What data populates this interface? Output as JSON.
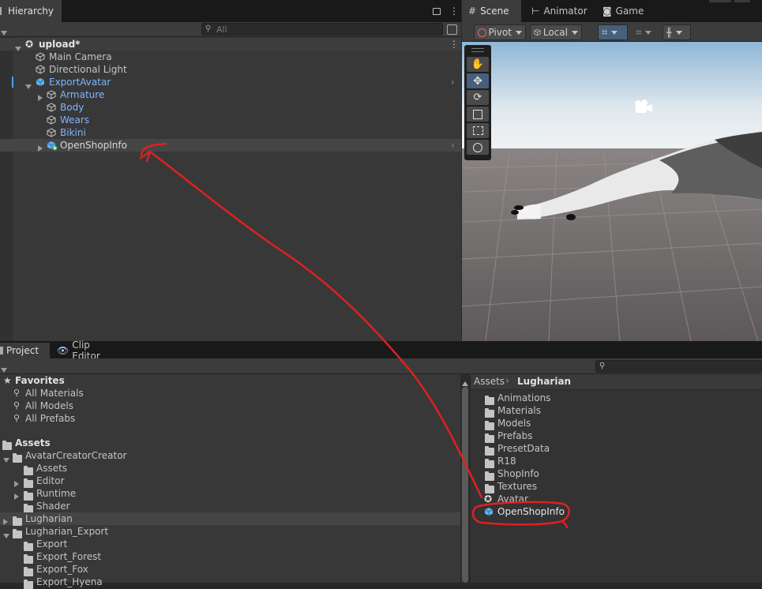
{
  "hierarchy": {
    "tab_label": "Hierarchy",
    "search_placeholder": "All",
    "scene_name": "upload*",
    "items": [
      {
        "label": "Main Camera"
      },
      {
        "label": "Directional Light"
      },
      {
        "label": "ExportAvatar"
      },
      {
        "label": "Armature"
      },
      {
        "label": "Body"
      },
      {
        "label": "Wears"
      },
      {
        "label": "Bikini"
      },
      {
        "label": "OpenShopInfo"
      }
    ]
  },
  "scene_tabs": {
    "scene": "Scene",
    "animator": "Animator",
    "game": "Game"
  },
  "scene_toolbar": {
    "pivot": "Pivot",
    "local": "Local"
  },
  "scene_tools": [
    "hand-tool",
    "move-tool",
    "rotate-tool",
    "scale-tool",
    "rect-tool",
    "transform-tool"
  ],
  "project": {
    "tab_label": "Project",
    "clip_tab_label": "Clip Editor",
    "favorites_label": "Favorites",
    "favorites": [
      "All Materials",
      "All Models",
      "All Prefabs"
    ],
    "assets_label": "Assets",
    "tree": [
      {
        "label": "AvatarCreatorCreator"
      },
      {
        "label": "Assets"
      },
      {
        "label": "Editor"
      },
      {
        "label": "Runtime"
      },
      {
        "label": "Shader"
      },
      {
        "label": "Lugharian"
      },
      {
        "label": "Lugharian_Export"
      },
      {
        "label": "Export"
      },
      {
        "label": "Export_Forest"
      },
      {
        "label": "Export_Fox"
      },
      {
        "label": "Export_Hyena"
      }
    ],
    "breadcrumb_root": "Assets",
    "breadcrumb_current": "Lugharian",
    "files": [
      {
        "label": "Animations"
      },
      {
        "label": "Materials"
      },
      {
        "label": "Models"
      },
      {
        "label": "Prefabs"
      },
      {
        "label": "PresetData"
      },
      {
        "label": "R18"
      },
      {
        "label": "ShopInfo"
      },
      {
        "label": "Textures"
      },
      {
        "label": "Avatar"
      },
      {
        "label": "OpenShopInfo"
      }
    ]
  },
  "colors": {
    "annotation": "#e02020",
    "selection_text": "#80b4ff",
    "accent": "#46607c"
  }
}
